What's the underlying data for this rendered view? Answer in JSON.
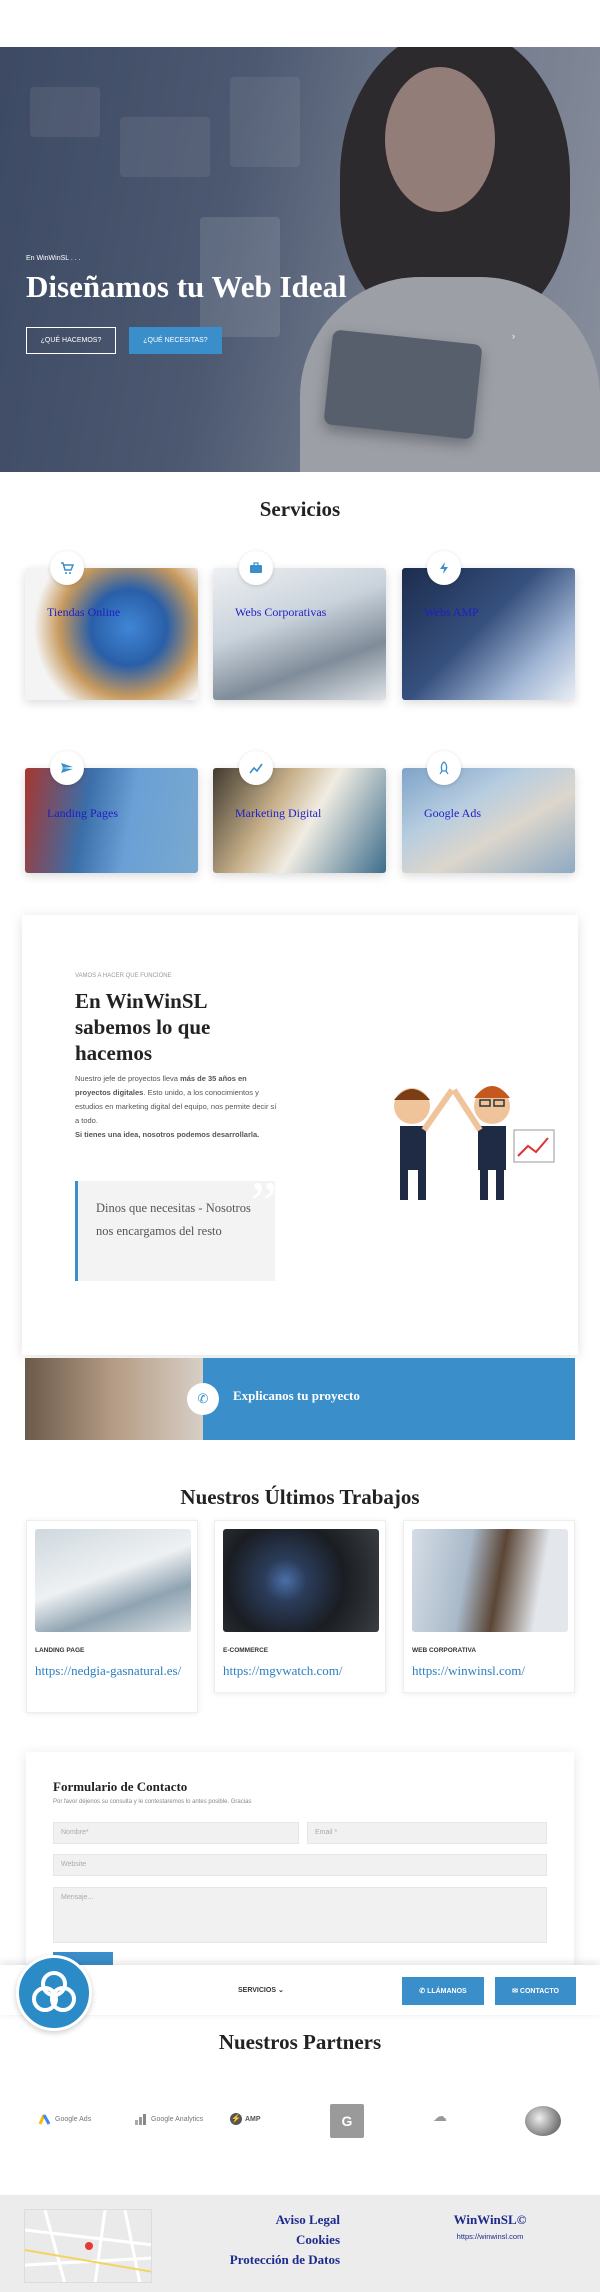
{
  "hero": {
    "kicker": "En WinWinSL . . .",
    "title": "Diseñamos tu Web Ideal",
    "btn_que_hacemos": "¿QUÉ HACEMOS?",
    "btn_que_necesitas": "¿QUÉ NECESITAS?"
  },
  "services": {
    "title": "Servicios",
    "items": [
      {
        "label": "Tiendas Online",
        "icon": "cart-icon"
      },
      {
        "label": "Webs Corporativas",
        "icon": "briefcase-icon"
      },
      {
        "label": "Webs AMP",
        "icon": "lightning-icon"
      },
      {
        "label": "Landing Pages",
        "icon": "plane-icon"
      },
      {
        "label": "Marketing Digital",
        "icon": "chart-line-icon"
      },
      {
        "label": "Google Ads",
        "icon": "rocket-icon"
      }
    ]
  },
  "about": {
    "kicker": "VAMOS A HACER QUE FUNCIONE",
    "title": "En WinWinSL sabemos lo que hacemos",
    "p1": "Nuestro jefe de proyectos lleva ",
    "p1_bold": "más de 35 años en proyectos digitales",
    "p1_rest": ". Esto unido, a los conocimientos y estudios en marketing digital del equipo, nos permite decir sí a todo.",
    "p2": "Si tienes una idea, nosotros podemos desarrollarla.",
    "quote": "Dinos que necesitas - Nosotros nos encargamos del resto"
  },
  "cta": {
    "text": "Explicanos tu proyecto"
  },
  "works": {
    "title": "Nuestros Últimos Trabajos",
    "items": [
      {
        "category": "LANDING PAGE",
        "link": "https://nedgia-gasnatural.es/"
      },
      {
        "category": "E-COMMERCE",
        "link": "https://mgvwatch.com/"
      },
      {
        "category": "WEB CORPORATIVA",
        "link": "https://winwinsl.com/"
      }
    ]
  },
  "form": {
    "title": "Formulario de Contacto",
    "subtitle": "Por favor déjenos su consulta y le contestaremos lo antes posible. Gracias",
    "name_placeholder": "Nombre*",
    "email_placeholder": "Email *",
    "website_placeholder": "Website",
    "message_placeholder": "Mensaje..."
  },
  "bar": {
    "menu": "SERVICIOS ⌄",
    "call": "LLÁMANOS",
    "contact": "CONTACTO"
  },
  "partners": {
    "title": "Nuestros Partners",
    "items": [
      "Google Ads",
      "Google Analytics",
      "AMP",
      "Google Translate",
      "Google Cloud",
      "Wordpress"
    ]
  },
  "footer": {
    "legal": "Aviso Legal",
    "cookies": "Cookies",
    "privacy": "Protección de Datos",
    "brand": "WinWinSL©",
    "url": "https://winwinsl.com"
  },
  "colors": {
    "accent": "#3a8fca",
    "link": "#1e2a8c"
  }
}
